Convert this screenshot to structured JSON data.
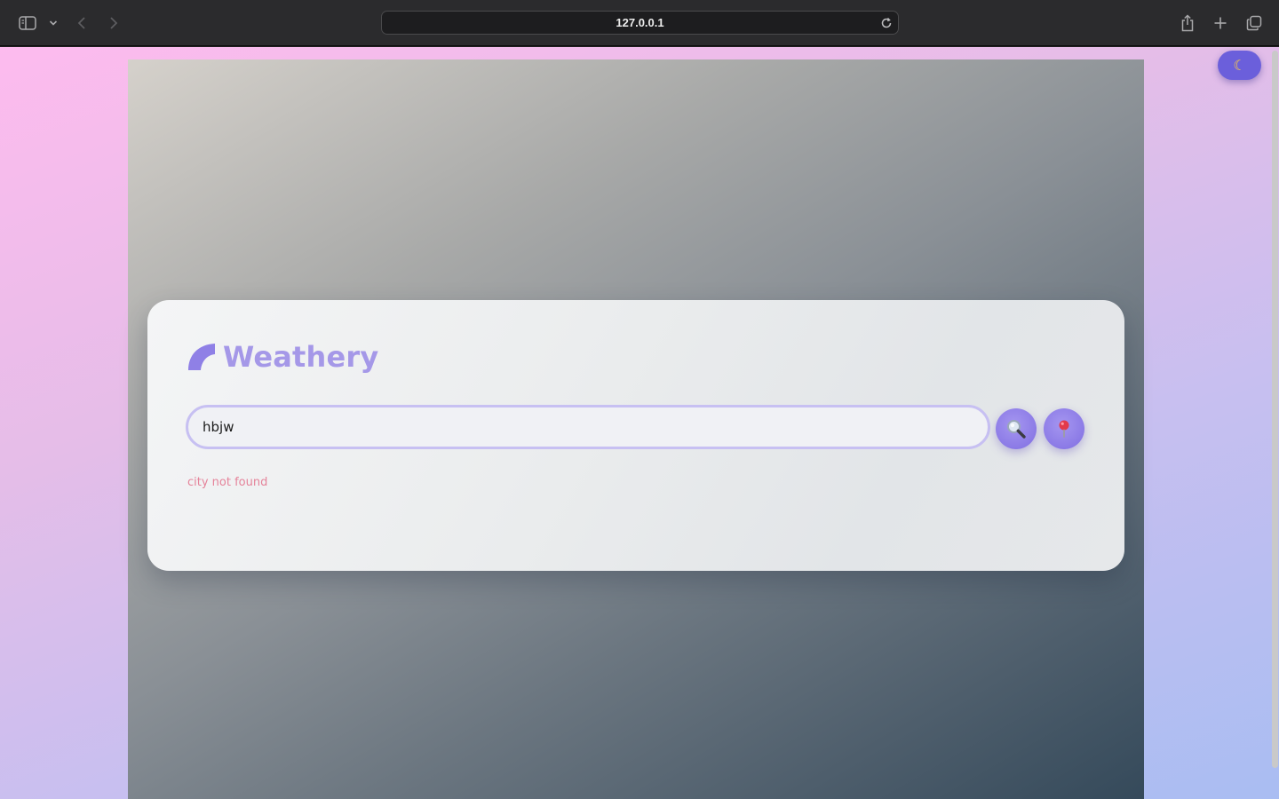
{
  "browser": {
    "url": "127.0.0.1"
  },
  "app": {
    "brand_name": "Weathery",
    "search": {
      "value": "hbjw",
      "placeholder": ""
    },
    "error_message": "city not found",
    "theme_toggle_icon": "moon-icon",
    "search_button_icon": "magnifier-icon",
    "location_button_icon": "pin-icon"
  },
  "colors": {
    "accent": "#8b7ae6",
    "brand_text": "#a598e8",
    "error": "#e5839a",
    "theme_toggle": "#6b5fdb"
  }
}
